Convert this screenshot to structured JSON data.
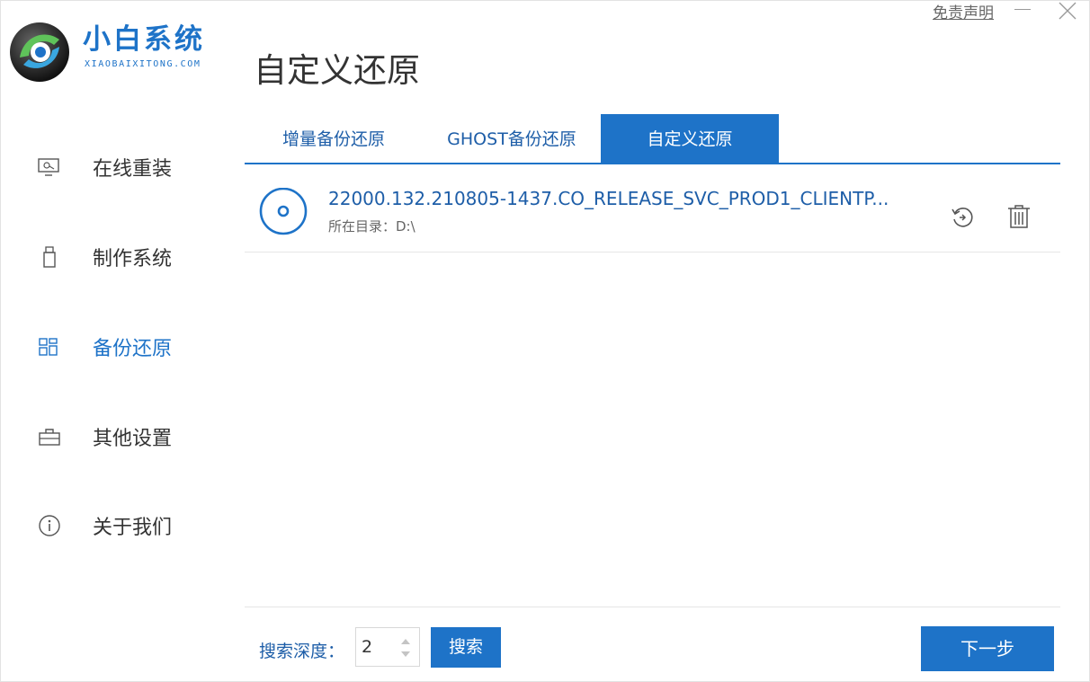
{
  "app": {
    "brand_name": "小白系统",
    "brand_sub": "XIAOBAIXITONG.COM",
    "disclaimer": "免责声明",
    "page_title": "自定义还原"
  },
  "sidebar": {
    "items": [
      {
        "label": "在线重装",
        "icon": "monitor-icon",
        "active": false
      },
      {
        "label": "制作系统",
        "icon": "usb-drive-icon",
        "active": false
      },
      {
        "label": "备份还原",
        "icon": "backup-restore-icon",
        "active": true
      },
      {
        "label": "其他设置",
        "icon": "toolbox-icon",
        "active": false
      },
      {
        "label": "关于我们",
        "icon": "info-icon",
        "active": false
      }
    ]
  },
  "tabs": [
    {
      "label": "增量备份还原",
      "active": false
    },
    {
      "label": "GHOST备份还原",
      "active": false
    },
    {
      "label": "自定义还原",
      "active": true
    }
  ],
  "backups": [
    {
      "name": "22000.132.210805-1437.CO_RELEASE_SVC_PROD1_CLIENTP...",
      "directory": "所在目录：D:\\"
    }
  ],
  "footer": {
    "depth_label": "搜索深度：",
    "depth_value": "2",
    "search_label": "搜索",
    "next_label": "下一步"
  },
  "colors": {
    "accent": "#1e73c8",
    "link_text": "#1e5ea8"
  }
}
